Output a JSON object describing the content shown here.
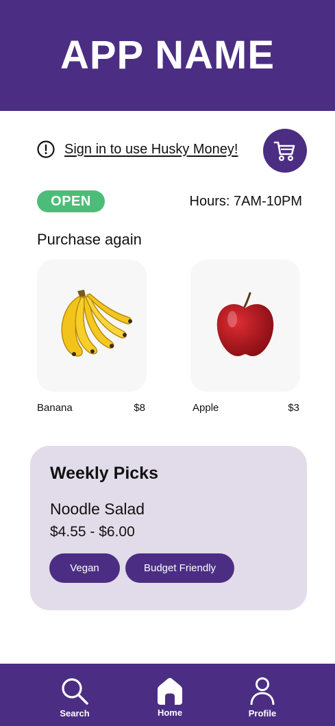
{
  "header": {
    "title": "APP NAME"
  },
  "signin": {
    "text": "Sign in to use Husky Money!"
  },
  "status": {
    "badge": "OPEN",
    "hours": "Hours: 7AM-10PM"
  },
  "purchase_again": {
    "title": "Purchase again",
    "items": [
      {
        "name": "Banana",
        "price": "$8"
      },
      {
        "name": "Apple",
        "price": "$3"
      }
    ]
  },
  "weekly_picks": {
    "title": "Weekly Picks",
    "dish": "Noodle Salad",
    "price_range": "$4.55 - $6.00",
    "tags": [
      "Vegan",
      "Budget Friendly"
    ]
  },
  "bottom_nav": {
    "items": [
      {
        "label": "Search",
        "icon": "search-icon"
      },
      {
        "label": "Home",
        "icon": "home-icon"
      },
      {
        "label": "Profile",
        "icon": "profile-icon"
      }
    ]
  },
  "colors": {
    "brand": "#4b2e83",
    "open": "#4cbd78",
    "card": "#e2dcea"
  }
}
